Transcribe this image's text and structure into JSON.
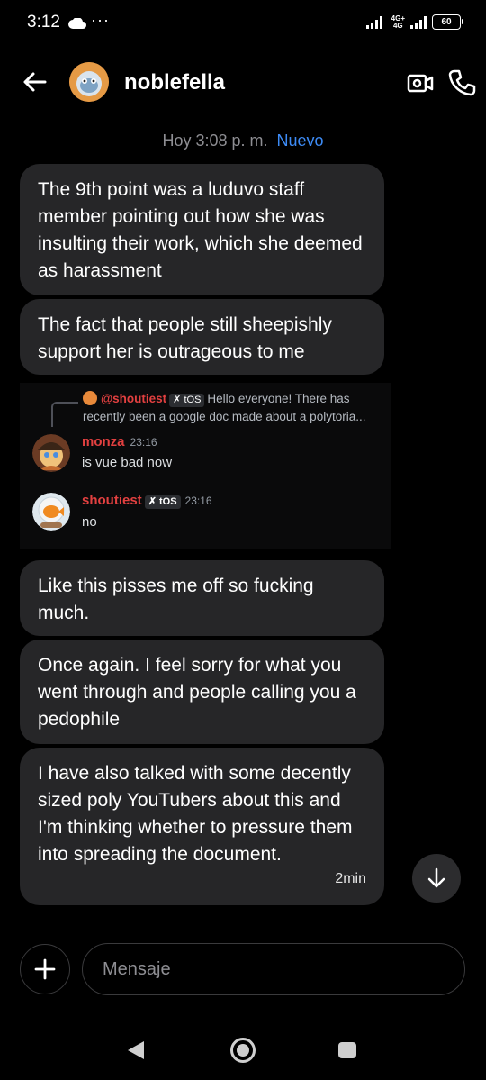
{
  "status_bar": {
    "time": "3:12",
    "network_top": "4G+",
    "network_bottom": "4G",
    "battery": "60"
  },
  "header": {
    "username": "noblefella"
  },
  "divider": {
    "time_label": "Hoy 3:08 p. m.",
    "new_label": "Nuevo"
  },
  "messages_top": [
    {
      "text": "The 9th point was a luduvo staff member pointing out how she was insulting their work, which she deemed as harassment"
    },
    {
      "text": "The fact that people still sheepishly support her is outrageous to me"
    }
  ],
  "shared_image": {
    "reply": {
      "author": "@shoutiest",
      "tag": "tOS",
      "text": "Hello everyone!  There has recently been a google doc made about a polytoria..."
    },
    "messages": [
      {
        "author": "monza",
        "time": "23:16",
        "text": "is vue bad now"
      },
      {
        "author": "shoutiest",
        "tag": "tOS",
        "time": "23:16",
        "text": "no"
      }
    ]
  },
  "messages_bottom": [
    {
      "text": "Like this pisses me off so fucking much."
    },
    {
      "text": "Once again. I feel sorry for what you went through and people calling you a pedophile"
    },
    {
      "text": "I have also talked with some decently sized poly YouTubers about this and I'm thinking whether to pressure them into spreading the document.",
      "time": "2min"
    }
  ],
  "composer": {
    "placeholder": "Mensaje"
  },
  "colors": {
    "bubble": "#262628",
    "accent_blue": "#3d8bf5",
    "discord_red": "#e24040"
  }
}
